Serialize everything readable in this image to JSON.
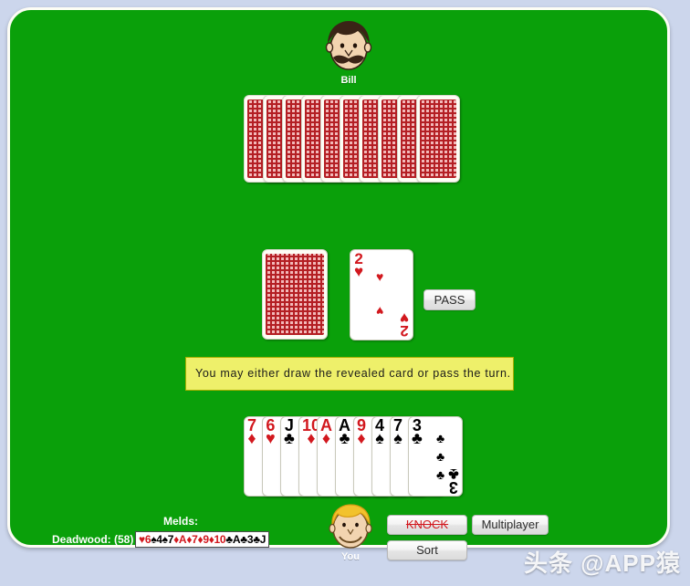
{
  "colors": {
    "table_green": "#0aa00a",
    "page_background": "#ccd6ec",
    "message_yellow": "#eef06a",
    "red_suit": "#d2181e",
    "black_suit": "#000000",
    "card_back_red": "#b41f24"
  },
  "opponent": {
    "name": "Bill",
    "avatar_icon": "mustache-face-icon",
    "hand_card_count": 10
  },
  "player": {
    "name": "You",
    "avatar_icon": "blond-face-icon",
    "hand": [
      {
        "rank": "7",
        "suit": "♦",
        "color": "red",
        "name": "7-of-diamonds"
      },
      {
        "rank": "6",
        "suit": "♥",
        "color": "red",
        "name": "6-of-hearts"
      },
      {
        "rank": "J",
        "suit": "♣",
        "color": "black",
        "name": "jack-of-clubs"
      },
      {
        "rank": "10",
        "suit": "♦",
        "color": "red",
        "name": "10-of-diamonds"
      },
      {
        "rank": "A",
        "suit": "♦",
        "color": "red",
        "name": "ace-of-diamonds"
      },
      {
        "rank": "A",
        "suit": "♣",
        "color": "black",
        "name": "ace-of-clubs"
      },
      {
        "rank": "9",
        "suit": "♦",
        "color": "red",
        "name": "9-of-diamonds"
      },
      {
        "rank": "4",
        "suit": "♠",
        "color": "black",
        "name": "4-of-spades"
      },
      {
        "rank": "7",
        "suit": "♠",
        "color": "black",
        "name": "7-of-spades"
      },
      {
        "rank": "3",
        "suit": "♣",
        "color": "black",
        "name": "3-of-clubs"
      }
    ]
  },
  "discard": {
    "rank": "2",
    "suit": "♥",
    "color": "red",
    "pip_count": 2
  },
  "stock": {
    "label": "stock-pile"
  },
  "message": {
    "text": "You may either draw the revealed card or pass the turn."
  },
  "buttons": {
    "pass": "PASS",
    "knock": "KNOCK",
    "multiplayer": "Multiplayer",
    "sort": "Sort"
  },
  "status": {
    "melds_label": "Melds:",
    "deadwood_label": "Deadwood: (58)",
    "deadwood_cards": [
      {
        "suit": "♥",
        "rank": "6",
        "color": "red"
      },
      {
        "suit": "♠",
        "rank": "4",
        "color": "black"
      },
      {
        "suit": "♠",
        "rank": "7",
        "color": "black"
      },
      {
        "suit": "♦",
        "rank": "A",
        "color": "red"
      },
      {
        "suit": "♦",
        "rank": "7",
        "color": "red"
      },
      {
        "suit": "♦",
        "rank": "9",
        "color": "red"
      },
      {
        "suit": "♦",
        "rank": "10",
        "color": "red"
      },
      {
        "suit": "♣",
        "rank": "A",
        "color": "black"
      },
      {
        "suit": "♣",
        "rank": "3",
        "color": "black"
      },
      {
        "suit": "♣",
        "rank": "J",
        "color": "black"
      }
    ]
  },
  "watermark": {
    "text": "头条 @APP猿"
  }
}
